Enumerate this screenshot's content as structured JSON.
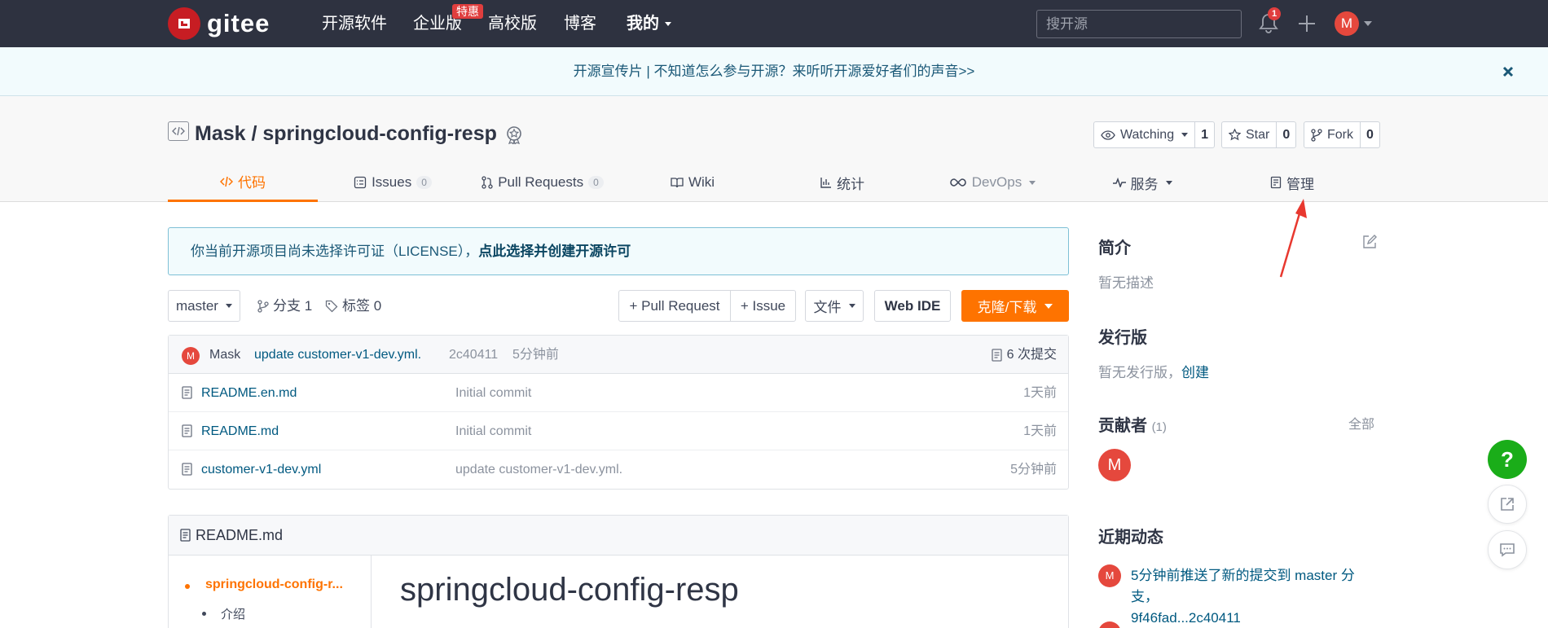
{
  "topnav": {
    "logo_text": "gitee",
    "items": [
      "开源软件",
      "企业版",
      "高校版",
      "博客",
      "我的"
    ],
    "enterprise_badge": "特惠",
    "search_placeholder": "搜开源",
    "notification_count": "1",
    "avatar_letter": "M"
  },
  "banner": {
    "text": "开源宣传片 | 不知道怎么参与开源？来听听开源爱好者们的声音>>"
  },
  "repo": {
    "title": "Mask / springcloud-config-resp",
    "watch_label": "Watching",
    "watch_count": "1",
    "star_label": "Star",
    "star_count": "0",
    "fork_label": "Fork",
    "fork_count": "0"
  },
  "tabs": [
    {
      "label": "代码",
      "icon": "code-icon"
    },
    {
      "label": "Issues",
      "count": "0",
      "icon": "issues-icon"
    },
    {
      "label": "Pull Requests",
      "count": "0",
      "icon": "pull-request-icon"
    },
    {
      "label": "Wiki",
      "icon": "wiki-icon"
    },
    {
      "label": "统计",
      "icon": "stats-icon"
    },
    {
      "label": "DevOps",
      "icon": "devops-icon"
    },
    {
      "label": "服务",
      "icon": "service-icon"
    },
    {
      "label": "管理",
      "icon": "manage-icon"
    }
  ],
  "license_notice": {
    "text": "你当前开源项目尚未选择许可证（LICENSE），",
    "link": "点此选择并创建开源许可"
  },
  "toolbar": {
    "branch": "master",
    "branches": "分支 1",
    "tags": "标签 0",
    "pull_request": "+ Pull Request",
    "issue": "+ Issue",
    "files": "文件",
    "web_ide": "Web IDE",
    "clone": "克隆/下载"
  },
  "latest_commit": {
    "author": "Mask",
    "author_initial": "M",
    "message": "update customer-v1-dev.yml.",
    "hash": "2c40411",
    "time": "5分钟前",
    "commit_count": "6 次提交"
  },
  "files": [
    {
      "name": "README.en.md",
      "message": "Initial commit",
      "time": "1天前"
    },
    {
      "name": "README.md",
      "message": "Initial commit",
      "time": "1天前"
    },
    {
      "name": "customer-v1-dev.yml",
      "message": "update customer-v1-dev.yml.",
      "time": "5分钟前"
    }
  ],
  "readme": {
    "file_label": "README.md",
    "toc": [
      "springcloud-config-r...",
      "介绍"
    ],
    "heading": "springcloud-config-resp"
  },
  "sidebar": {
    "intro_title": "简介",
    "intro_text": "暂无描述",
    "release_title": "发行版",
    "release_text": "暂无发行版，",
    "release_link": "创建",
    "contributors_title": "贡献者",
    "contributors_count": "(1)",
    "contributors_all": "全部",
    "contributor_initial": "M",
    "activity_title": "近期动态",
    "activity_text_1": "5分钟前推送了新的提交到 master 分支，",
    "activity_text_2": "9f46fad...2c40411"
  },
  "float_buttons": {
    "help": "?"
  },
  "colors": {
    "nav_bg": "#2e3240",
    "accent_orange": "#fe7300",
    "brand_red": "#c71d23",
    "link_blue": "#005980",
    "help_green": "#1aad19"
  }
}
